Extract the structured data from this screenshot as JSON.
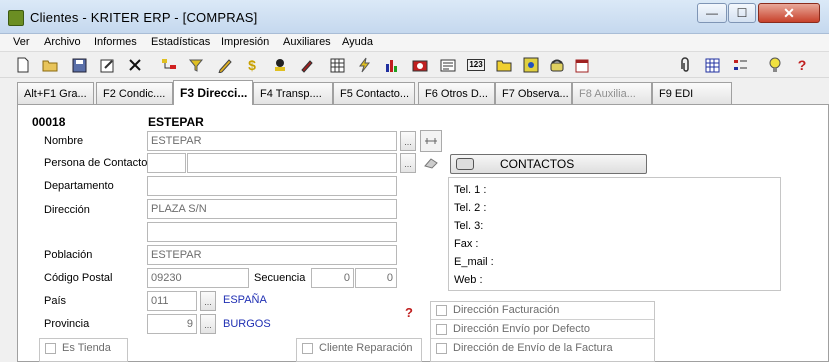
{
  "window": {
    "title": "Clientes - KRITER ERP - [COMPRAS]",
    "close_glyph": "✕",
    "max_glyph": "☐",
    "min_glyph": "—"
  },
  "menu": [
    "Ver",
    "Archivo",
    "Informes",
    "Estadísticas",
    "Impresión",
    "Auxiliares",
    "Ayuda"
  ],
  "toolbar": {
    "icons": [
      "new-document-icon",
      "open-folder-icon",
      "save-disk-icon",
      "edit-form-icon",
      "delete-x-icon",
      "tree-icon",
      "filter-icon",
      "pencil-icon",
      "money-icon",
      "stamp-icon",
      "brush-icon",
      "calculator-icon",
      "lightning-icon",
      "bar-chart-icon",
      "camera-icon",
      "card-icon",
      "numbers-icon",
      "folder-yellow-icon",
      "map-icon",
      "phone-icon",
      "calendar-icon",
      "paperclip-icon",
      "grid-icon",
      "list-icon",
      "lightbulb-icon",
      "help-icon"
    ]
  },
  "tabs": [
    {
      "label": "Alt+F1 Gra...",
      "state": "normal"
    },
    {
      "label": "F2 Condic....",
      "state": "normal"
    },
    {
      "label": "F3 Direcci...",
      "state": "active"
    },
    {
      "label": "F4 Transp....",
      "state": "normal"
    },
    {
      "label": "F5 Contacto...",
      "state": "normal"
    },
    {
      "label": "F6 Otros D...",
      "state": "normal"
    },
    {
      "label": "F7 Observa...",
      "state": "normal"
    },
    {
      "label": "F8 Auxilia...",
      "state": "disabled"
    },
    {
      "label": "F9 EDI",
      "state": "normal"
    }
  ],
  "form": {
    "code": "00018",
    "name_header": "ESTEPAR",
    "labels": {
      "nombre": "Nombre",
      "persona": "Persona de Contacto",
      "departamento": "Departamento",
      "direccion": "Dirección",
      "poblacion": "Población",
      "codigo_postal": "Código Postal",
      "secuencia": "Secuencia",
      "pais": "País",
      "provincia": "Provincia"
    },
    "values": {
      "nombre": "ESTEPAR",
      "persona_a": "",
      "persona_b": "",
      "departamento": "",
      "direccion_1": "PLAZA S/N",
      "direccion_2": "",
      "poblacion": "ESTEPAR",
      "codigo_postal": "09230",
      "secuencia_1": "0",
      "secuencia_2": "0",
      "pais_code": "011",
      "pais_name": "ESPAÑA",
      "provincia_code": "9",
      "provincia_name": "BURGOS"
    },
    "ellipsis": "..."
  },
  "contactos": {
    "button_label": "CONTACTOS",
    "lines": [
      "Tel. 1 :",
      "Tel. 2 :",
      "Tel. 3:",
      "Fax :",
      "E_mail :",
      "Web :"
    ]
  },
  "checkboxes": {
    "es_tienda": "Es Tienda",
    "cliente_reparacion": "Cliente Reparación",
    "direccion_facturacion": "Dirección Facturación",
    "direccion_envio_defecto": "Dirección Envío por Defecto",
    "direccion_envio_factura": "Dirección de Envío de la Factura"
  }
}
